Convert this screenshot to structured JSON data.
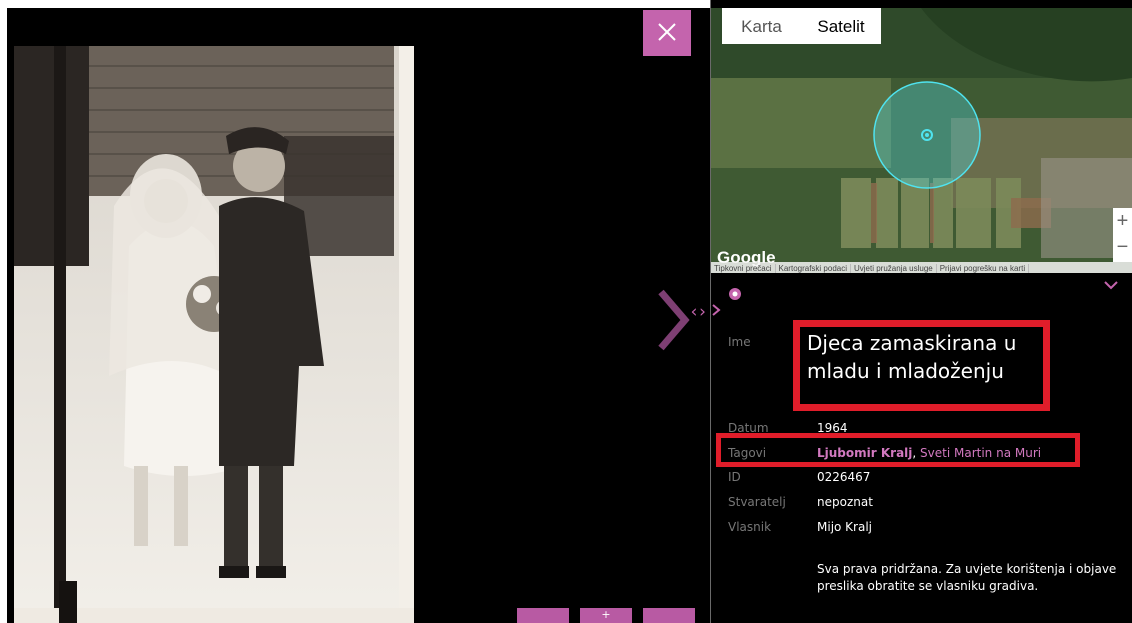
{
  "viewer": {
    "close_icon": "close-icon",
    "next_icon": "chevron-right-icon",
    "bottom_buttons": [
      "",
      "+",
      ""
    ]
  },
  "panel_toggle": {
    "glyph": "‹›"
  },
  "map": {
    "tabs": [
      "Karta",
      "Satelit"
    ],
    "selected_tab": "Satelit",
    "logo": "Google",
    "attribution": [
      "Tipkovni prečaci",
      "Kartografski podaci",
      "Uvjeti pružanja usluge",
      "Prijavi pogrešku na karti"
    ],
    "zoom_in": "+",
    "zoom_out": "−"
  },
  "details": {
    "name_label": "Ime",
    "name_value": "Djeca zamaskirana u mladu i mladoženju",
    "date_label": "Datum",
    "date_value": "1964",
    "tags_label": "Tagovi",
    "tag_1": "Ljubomir Kralj",
    "tag_sep": ", ",
    "tag_2": "Sveti Martin na Muri",
    "id_label": "ID",
    "id_value": "0226467",
    "creator_label": "Stvaratelj",
    "creator_value": "nepoznat",
    "owner_label": "Vlasnik",
    "owner_value": "Mijo Kralj",
    "rights_text": "Sva prava pridržana. Za uvjete korištenja i objave preslika obratite se vlasniku gradiva."
  },
  "colors": {
    "accent": "#c464ad",
    "highlight": "#e01d2a",
    "background": "#000000"
  }
}
